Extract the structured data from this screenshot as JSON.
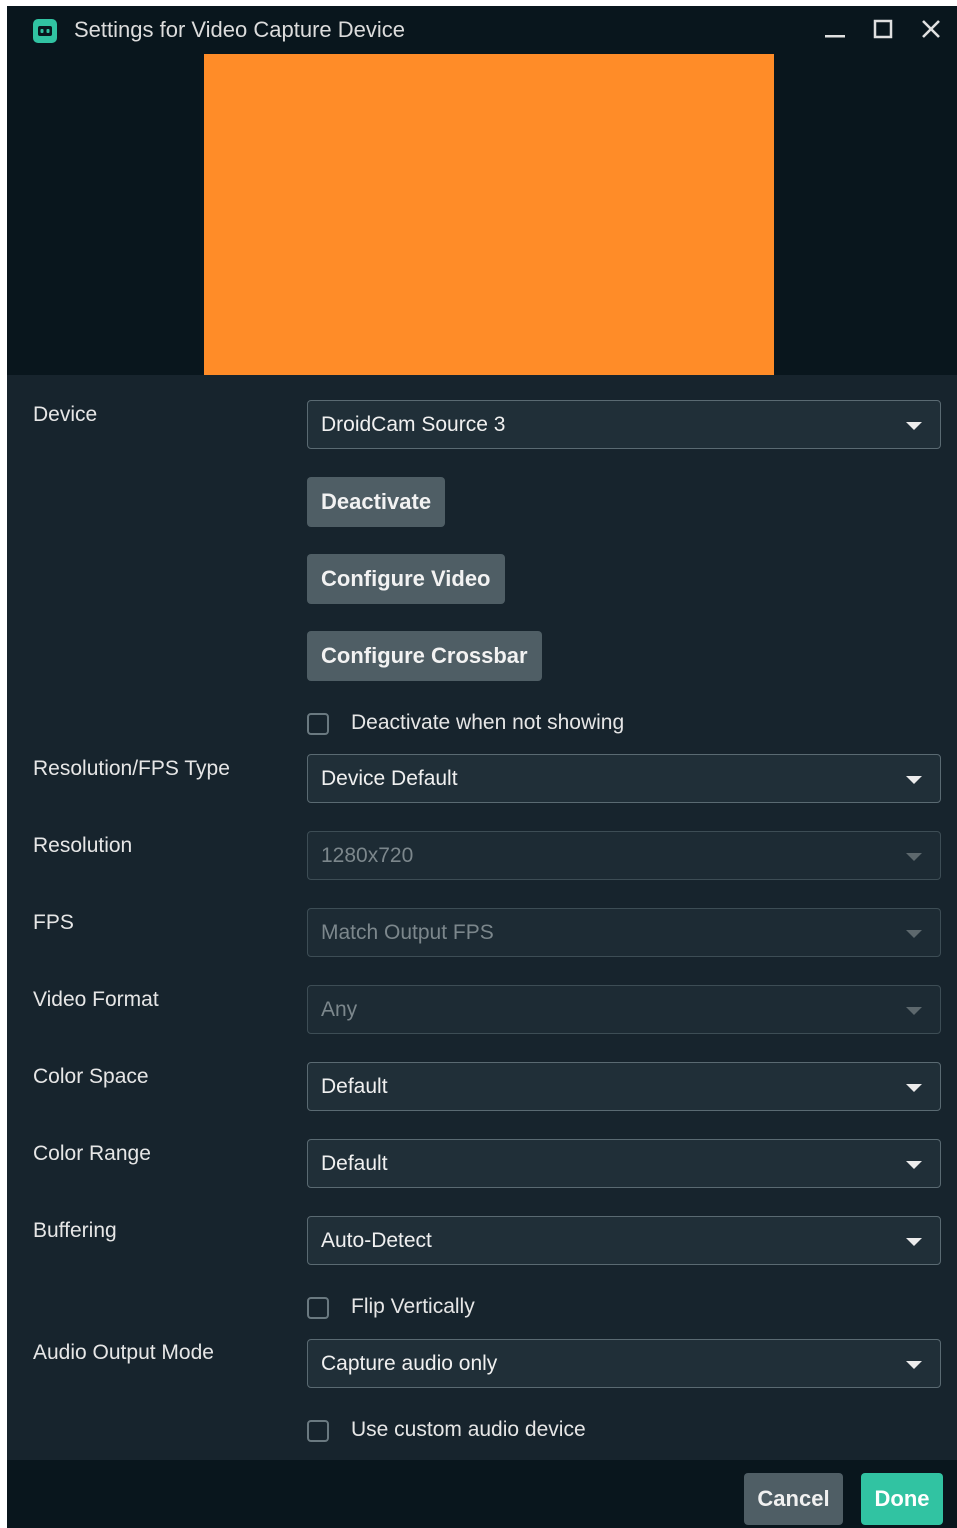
{
  "window": {
    "title": "Settings for Video Capture Device",
    "icon": "streamlabs-app-icon",
    "controls": [
      "minimize-icon",
      "maximize-icon",
      "close-icon"
    ]
  },
  "preview": {
    "fill_color": "#ff8c28"
  },
  "form": {
    "device": {
      "label": "Device",
      "value": "DroidCam Source 3"
    },
    "buttons": {
      "deactivate": "Deactivate",
      "configure_video": "Configure Video",
      "configure_crossbar": "Configure Crossbar"
    },
    "deactivate_when_not_showing": {
      "label": "Deactivate when not showing",
      "checked": false
    },
    "resolution_fps_type": {
      "label": "Resolution/FPS Type",
      "value": "Device Default"
    },
    "resolution": {
      "label": "Resolution",
      "value": "1280x720",
      "disabled": true
    },
    "fps": {
      "label": "FPS",
      "value": "Match Output FPS",
      "disabled": true
    },
    "video_format": {
      "label": "Video Format",
      "value": "Any",
      "disabled": true
    },
    "color_space": {
      "label": "Color Space",
      "value": "Default"
    },
    "color_range": {
      "label": "Color Range",
      "value": "Default"
    },
    "buffering": {
      "label": "Buffering",
      "value": "Auto-Detect"
    },
    "flip_vertically": {
      "label": "Flip Vertically",
      "checked": false
    },
    "audio_output_mode": {
      "label": "Audio Output Mode",
      "value": "Capture audio only"
    },
    "use_custom_audio_device": {
      "label": "Use custom audio device",
      "checked": false
    }
  },
  "footer": {
    "cancel_label": "Cancel",
    "done_label": "Done"
  },
  "colors": {
    "background": "#17242d",
    "titlebar": "#09161d",
    "accent": "#31c3a2",
    "button": "#4f5e65"
  }
}
